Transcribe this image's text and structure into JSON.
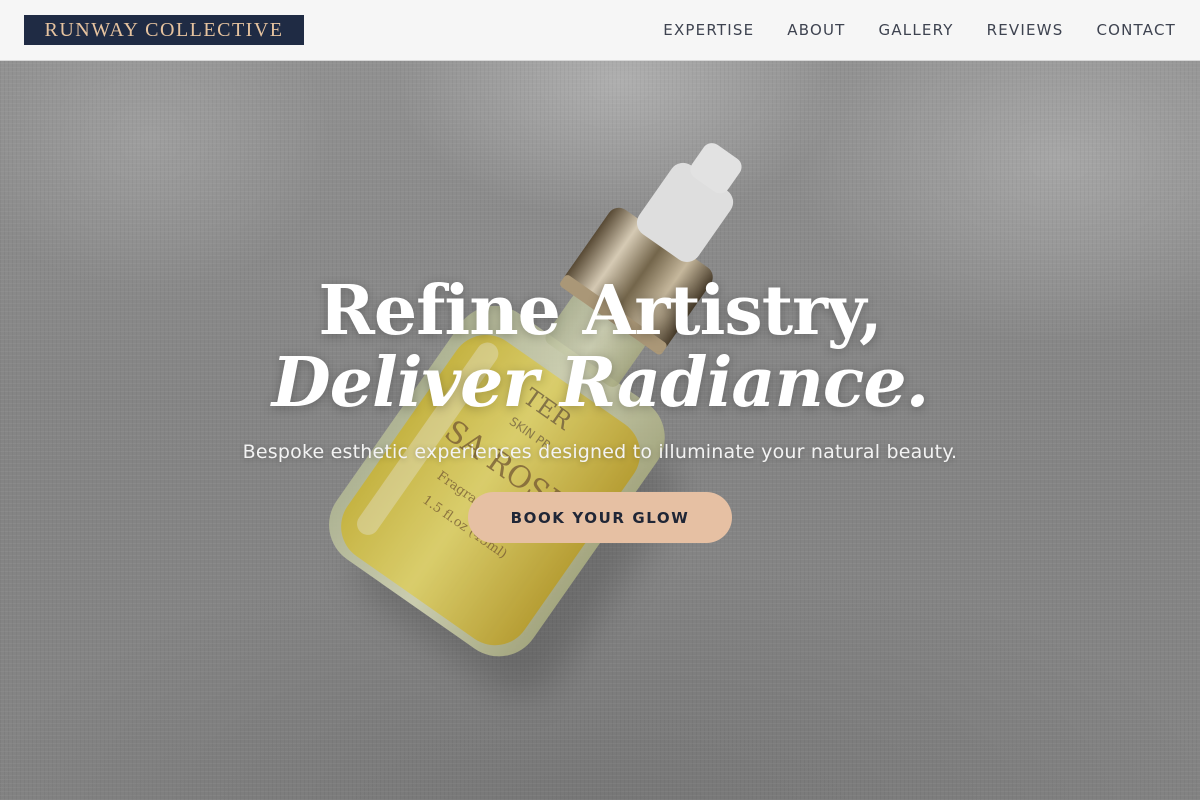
{
  "brand": {
    "name": "RUNWAY COLLECTIVE"
  },
  "nav": {
    "items": [
      {
        "label": "EXPERTISE"
      },
      {
        "label": "ABOUT"
      },
      {
        "label": "GALLERY"
      },
      {
        "label": "REVIEWS"
      },
      {
        "label": "CONTACT"
      }
    ]
  },
  "hero": {
    "headline_line1": "Refine Artistry,",
    "headline_line2": "Deliver Radiance.",
    "subtitle": "Bespoke esthetic experiences designed to illuminate your natural beauty.",
    "cta_label": "BOOK YOUR GLOW",
    "image": {
      "description_icon": "serum-bottle-photo",
      "bottle_label_lines": [
        "TER",
        "SKIN PR",
        "SA ROSE",
        "Fragrance Free",
        "1.5 fl.oz (45ml)"
      ]
    }
  },
  "colors": {
    "brand_navy": "#1f2b44",
    "brand_gold": "#e6c39f",
    "cta_peach": "#e6c0a3",
    "nav_text": "#3e4350"
  }
}
